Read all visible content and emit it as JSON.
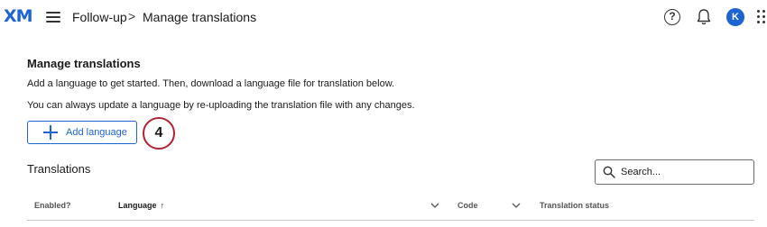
{
  "header": {
    "logo": "XM",
    "breadcrumb": [
      "Follow-up",
      "Manage translations"
    ],
    "breadcrumb_separator": ">",
    "help_icon": "?",
    "avatar_initial": "K",
    "icons": [
      "hamburger-menu-icon",
      "help-icon",
      "bell-icon",
      "apps-grid-icon"
    ]
  },
  "main": {
    "title": "Manage translations",
    "description_1": "Add a language to get started. Then, download a language file for translation below.",
    "description_2": "You can always update a language by re-uploading the translation file with any changes.",
    "add_language_label": "Add language",
    "step_badge": "4"
  },
  "translations": {
    "title": "Translations",
    "search_placeholder": "Search...",
    "columns": {
      "enabled": "Enabled?",
      "language": "Language",
      "language_sort_icon": "↑",
      "code": "Code",
      "status": "Translation status"
    }
  },
  "colors": {
    "accent": "#1d63d1",
    "badge_ring": "#b22234"
  }
}
